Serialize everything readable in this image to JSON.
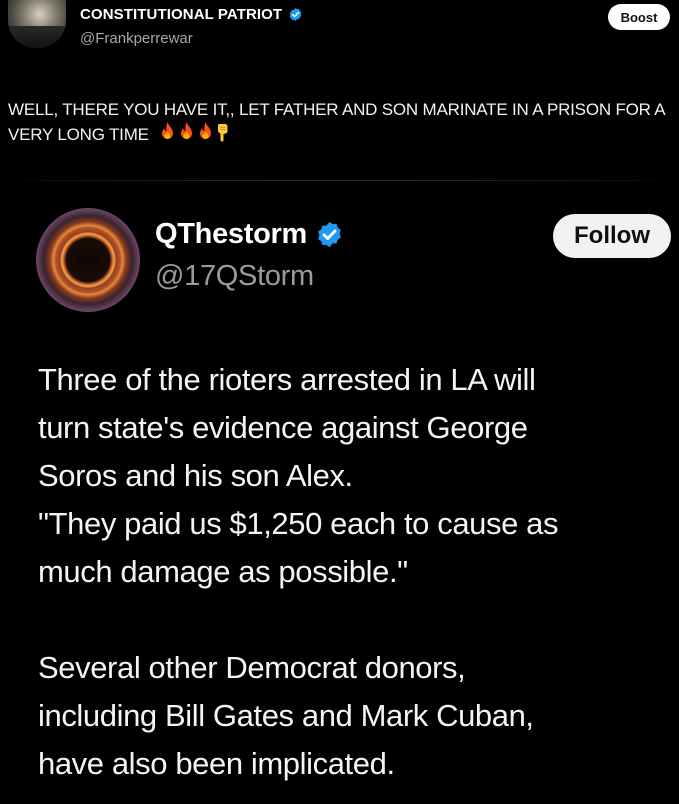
{
  "outer_post": {
    "author_name": "CONSTITUTIONAL PATRIOT",
    "handle": "@Frankperrewar",
    "boost_label": "Boost",
    "text": "WELL, THERE YOU HAVE IT,, LET FATHER AND SON MARINATE IN A PRISON FOR A VERY LONG TIME",
    "emojis": [
      "fire-emoji",
      "fire-emoji",
      "fire-emoji",
      "point-down-emoji"
    ]
  },
  "quoted_post": {
    "author_name": "QThestorm",
    "handle": "@17QStorm",
    "follow_label": "Follow",
    "lines": [
      "Three of the rioters arrested in LA will",
      "turn state's evidence against George",
      "Soros and his son Alex.",
      "\"They paid us $1,250 each to cause as",
      "much damage as possible.\"",
      "",
      "Several other Democrat donors,",
      "including Bill Gates and Mark Cuban,",
      "have also been implicated."
    ]
  },
  "colors": {
    "background": "#000000",
    "verified": "#1d9bf0",
    "handle_gray": "#9a9a9a",
    "button_bg": "#f2f2f2"
  }
}
